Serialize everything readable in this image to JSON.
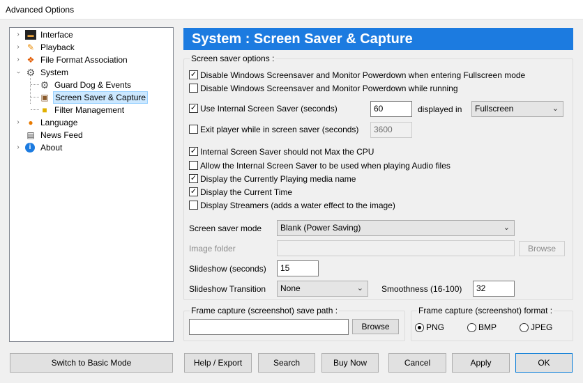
{
  "window": {
    "title": "Advanced Options"
  },
  "tree": {
    "items": [
      {
        "label": "Interface",
        "icon": "monitor-icon"
      },
      {
        "label": "Playback",
        "icon": "pencil-icon"
      },
      {
        "label": "File Format Association",
        "icon": "association-icon"
      },
      {
        "label": "System",
        "icon": "gear-icon"
      },
      {
        "label": "Guard Dog & Events",
        "icon": "gear-icon"
      },
      {
        "label": "Screen Saver & Capture",
        "icon": "screensaver-icon"
      },
      {
        "label": "Filter Management",
        "icon": "folder-icon"
      },
      {
        "label": "Language",
        "icon": "speech-bubble-icon"
      },
      {
        "label": "News Feed",
        "icon": "news-icon"
      },
      {
        "label": "About",
        "icon": "info-icon"
      }
    ]
  },
  "header": {
    "title": "System : Screen Saver & Capture"
  },
  "screensaver": {
    "group_title": "Screen saver options :",
    "opt_disable_fullscreen": "Disable Windows Screensaver and Monitor Powerdown when entering Fullscreen mode",
    "opt_disable_running": "Disable Windows Screensaver and Monitor Powerdown while running",
    "opt_use_internal": "Use Internal Screen Saver (seconds)",
    "internal_seconds": "60",
    "displayed_in_label": "displayed in",
    "displayed_in_value": "Fullscreen",
    "opt_exit_player": "Exit player while in screen saver (seconds)",
    "exit_seconds": "3600",
    "opt_no_max_cpu": "Internal Screen Saver should not Max the CPU",
    "opt_allow_audio": "Allow the Internal Screen Saver to be used when playing Audio files",
    "opt_display_media": "Display the Currently Playing media name",
    "opt_display_time": "Display the Current Time",
    "opt_display_streamers": "Display Streamers (adds a water effect to the image)",
    "mode_label": "Screen saver mode",
    "mode_value": "Blank (Power Saving)",
    "image_folder_label": "Image folder",
    "image_folder_value": "",
    "browse_label": "Browse",
    "slideshow_label": "Slideshow (seconds)",
    "slideshow_value": "15",
    "transition_label": "Slideshow Transition",
    "transition_value": "None",
    "smoothness_label": "Smoothness (16-100)",
    "smoothness_value": "32"
  },
  "capture_path": {
    "group_title": "Frame capture (screenshot) save path :",
    "path_value": "",
    "browse_label": "Browse"
  },
  "capture_format": {
    "group_title": "Frame capture (screenshot) format :",
    "options": [
      "PNG",
      "BMP",
      "JPEG"
    ],
    "selected": "PNG"
  },
  "buttons": {
    "basic_mode": "Switch to Basic Mode",
    "help_export": "Help / Export",
    "search": "Search",
    "buy_now": "Buy Now",
    "cancel": "Cancel",
    "apply": "Apply",
    "ok": "OK"
  },
  "check": "✓",
  "colors": {
    "header_bg": "#1c7be0",
    "selection_bg": "#cce8ff"
  }
}
